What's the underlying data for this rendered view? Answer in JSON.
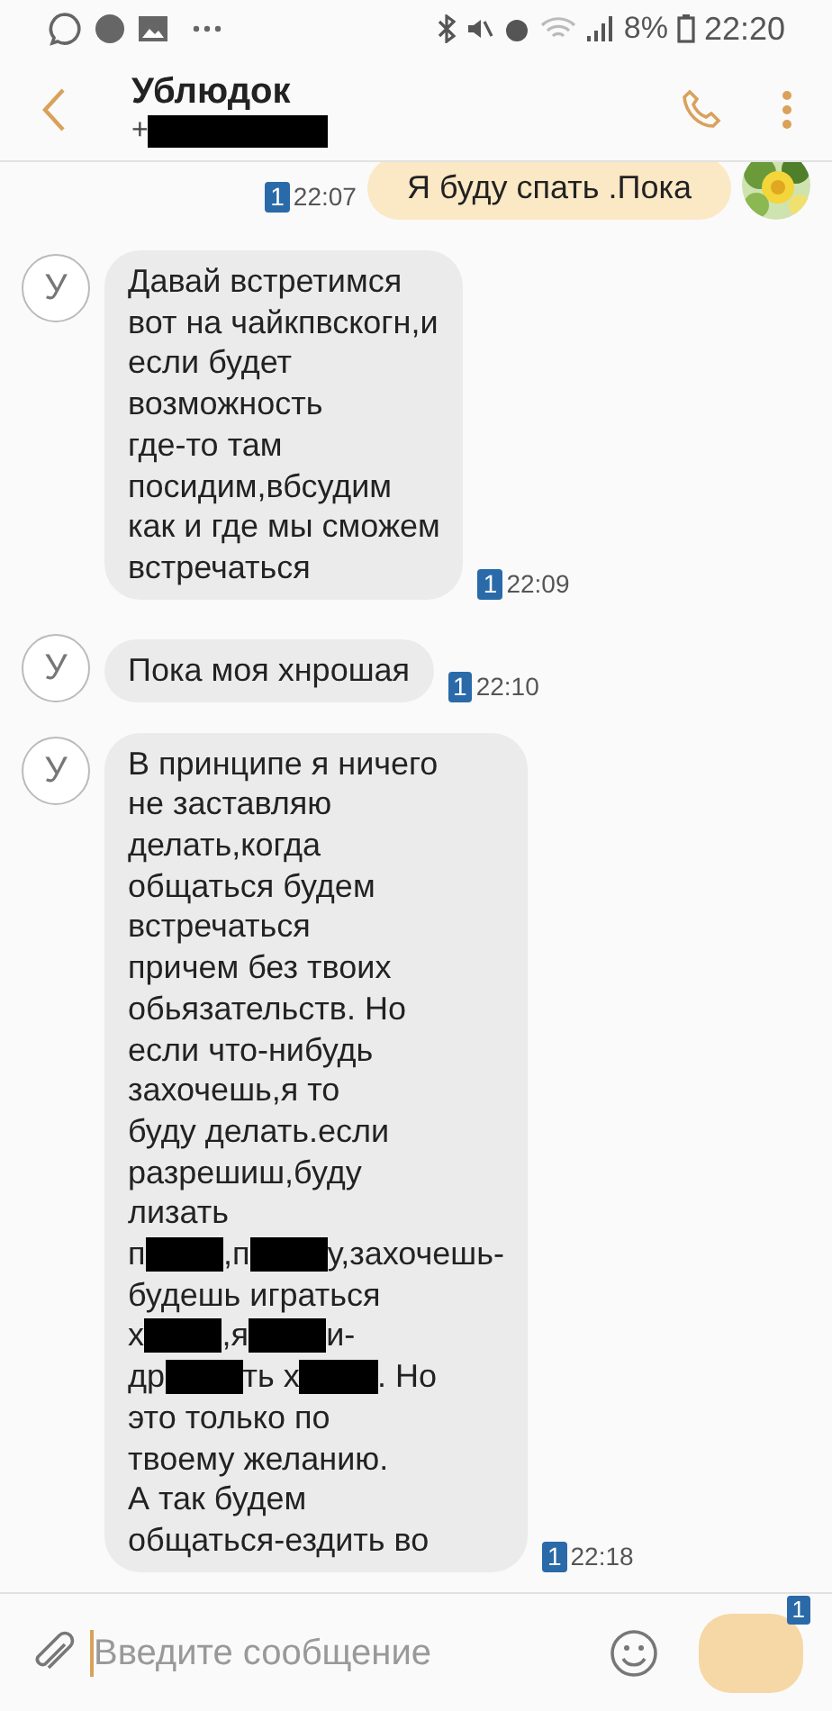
{
  "status_bar": {
    "battery": "8%",
    "time": "22:20"
  },
  "header": {
    "title": "Ублюдок",
    "phone": [
      {
        "kind": "text",
        "text": "+"
      },
      {
        "kind": "redaction"
      }
    ]
  },
  "messages": [
    {
      "kind": "outgoing",
      "sim": "1",
      "time": "22:07",
      "lines": [
        [
          {
            "kind": "text",
            "text": "Я буду спать .Пока"
          }
        ]
      ]
    },
    {
      "kind": "incoming",
      "avatar_letter": "У",
      "sim": "1",
      "time": "22:09",
      "lines": [
        [
          {
            "kind": "text",
            "text": "Давай встретимся"
          }
        ],
        [
          {
            "kind": "text",
            "text": "вот на чайкпвскогн,и"
          }
        ],
        [
          {
            "kind": "text",
            "text": "если будет"
          }
        ],
        [
          {
            "kind": "text",
            "text": "возможность"
          }
        ],
        [
          {
            "kind": "text",
            "text": "где-то там"
          }
        ],
        [
          {
            "kind": "text",
            "text": "посидим,вбсудим"
          }
        ],
        [
          {
            "kind": "text",
            "text": "как и где мы сможем"
          }
        ],
        [
          {
            "kind": "text",
            "text": "встречаться"
          }
        ]
      ]
    },
    {
      "kind": "incoming",
      "avatar_letter": "У",
      "sim": "1",
      "time": "22:10",
      "lines": [
        [
          {
            "kind": "text",
            "text": "Пока моя хнрошая"
          }
        ]
      ]
    },
    {
      "kind": "incoming",
      "avatar_letter": "У",
      "sim": "1",
      "time": "22:18",
      "lines": [
        [
          {
            "kind": "text",
            "text": "В принципе я ничего"
          }
        ],
        [
          {
            "kind": "text",
            "text": "не заставляю"
          }
        ],
        [
          {
            "kind": "text",
            "text": "делать,когда"
          }
        ],
        [
          {
            "kind": "text",
            "text": "общаться будем"
          }
        ],
        [
          {
            "kind": "text",
            "text": "встречаться"
          }
        ],
        [
          {
            "kind": "text",
            "text": "причем без твоих"
          }
        ],
        [
          {
            "kind": "text",
            "text": "обьязательств. Но"
          }
        ],
        [
          {
            "kind": "text",
            "text": "если что-нибудь"
          }
        ],
        [
          {
            "kind": "text",
            "text": "захочешь,я то"
          }
        ],
        [
          {
            "kind": "text",
            "text": "буду делать.если"
          }
        ],
        [
          {
            "kind": "text",
            "text": "разрешиш,буду"
          }
        ],
        [
          {
            "kind": "text",
            "text": "лизать"
          }
        ],
        [
          {
            "kind": "text",
            "text": "п"
          },
          {
            "kind": "redaction"
          },
          {
            "kind": "text",
            "text": ",п"
          },
          {
            "kind": "redaction"
          },
          {
            "kind": "text",
            "text": "у,захочешь-"
          }
        ],
        [
          {
            "kind": "text",
            "text": "будешь играться"
          }
        ],
        [
          {
            "kind": "text",
            "text": "х"
          },
          {
            "kind": "redaction"
          },
          {
            "kind": "text",
            "text": ",я"
          },
          {
            "kind": "redaction"
          },
          {
            "kind": "text",
            "text": "и-"
          }
        ],
        [
          {
            "kind": "text",
            "text": "др"
          },
          {
            "kind": "redaction"
          },
          {
            "kind": "text",
            "text": "ть х"
          },
          {
            "kind": "redaction"
          },
          {
            "kind": "text",
            "text": ". Но"
          }
        ],
        [
          {
            "kind": "text",
            "text": "это только по"
          }
        ],
        [
          {
            "kind": "text",
            "text": "твоему желанию."
          }
        ],
        [
          {
            "kind": "text",
            "text": "А так будем"
          }
        ],
        [
          {
            "kind": "text",
            "text": "общаться-ездить во"
          }
        ]
      ]
    }
  ],
  "composer": {
    "placeholder": "Введите сообщение",
    "send_sim": "1"
  }
}
